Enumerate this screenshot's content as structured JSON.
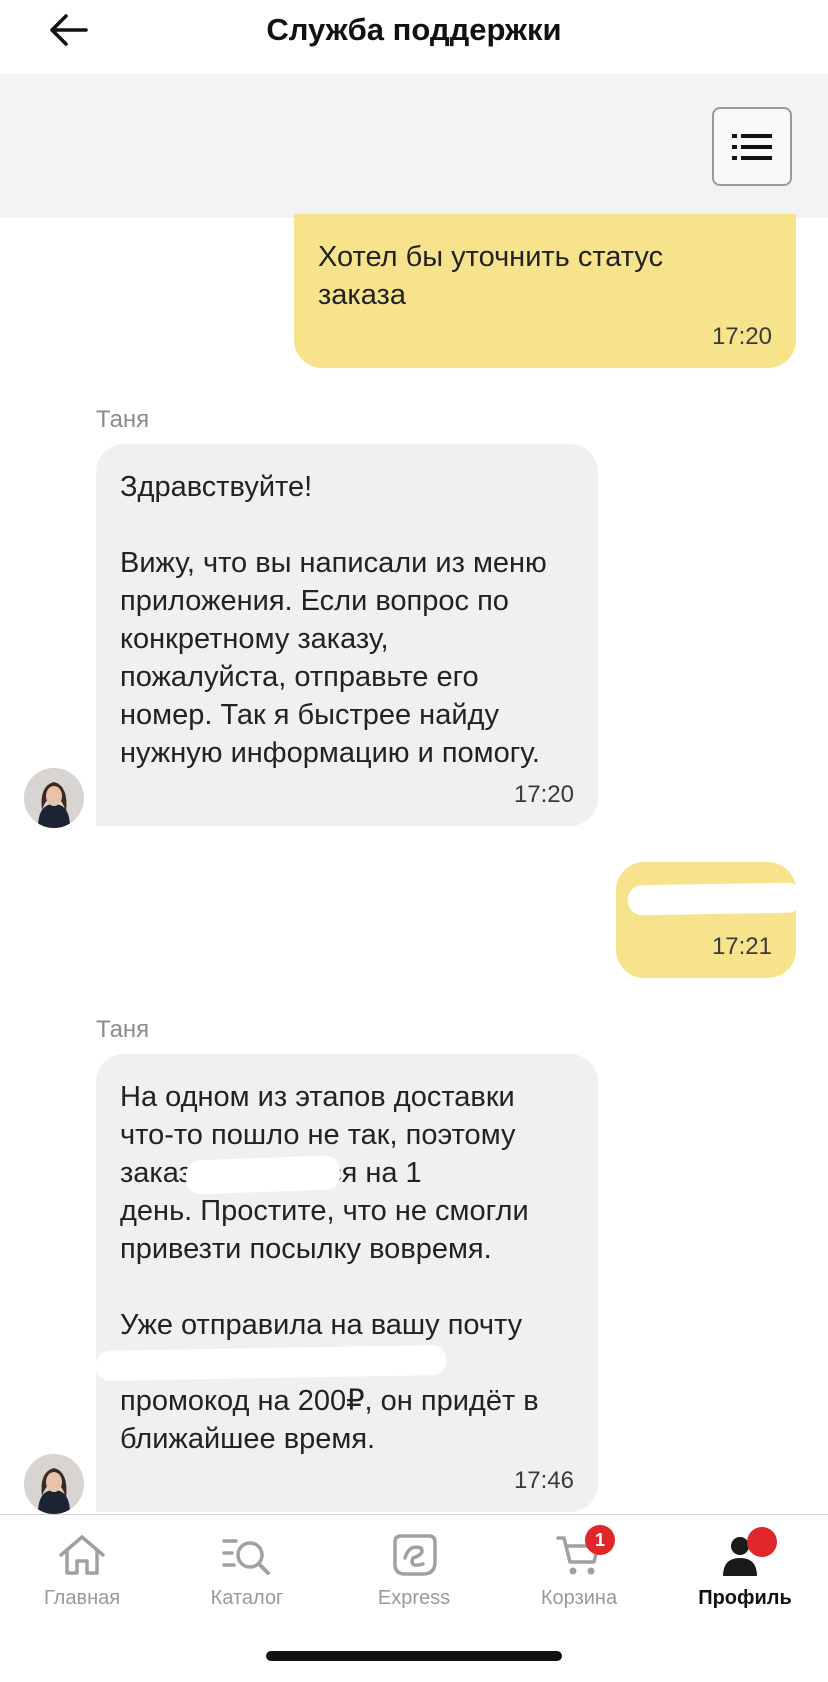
{
  "header": {
    "title": "Служба поддержки"
  },
  "messages": [
    {
      "dir": "out",
      "text": "Хотел бы уточнить статус\nзаказа",
      "time": "17:20"
    },
    {
      "dir": "in",
      "sender": "Таня",
      "text": "Здравствуйте!\n\nВижу, что вы написали из меню\nприложения. Если вопрос по\nконкретному заказу,\nпожалуйста, отправьте его\nномер. Так я быстрее найду\nнужную информацию и помогу.",
      "time": "17:20"
    },
    {
      "dir": "out",
      "text": "",
      "time": "17:21"
    },
    {
      "dir": "in",
      "sender": "Таня",
      "text": "На одном из этапов доставки\nчто-то пошло не так, поэтому\nзаказ               задержится на 1\nдень. Простите, что не смогли\nпривезти посылку вовремя.\n\nУже отправила на вашу почту\n\nпромокод на 200₽, он придёт в\nближайшее время.",
      "time": "17:46"
    }
  ],
  "tabbar": {
    "tabs": [
      {
        "label": "Главная",
        "icon": "home-icon"
      },
      {
        "label": "Каталог",
        "icon": "catalog-search-icon"
      },
      {
        "label": "Express",
        "icon": "express-icon"
      },
      {
        "label": "Корзина",
        "icon": "cart-icon",
        "badge": "1"
      },
      {
        "label": "Профиль",
        "icon": "profile-icon",
        "active": true
      }
    ]
  },
  "colors": {
    "outgoing_bubble": "#f8e38d",
    "incoming_bubble": "#f0f0f0",
    "badge": "#e0262b"
  }
}
